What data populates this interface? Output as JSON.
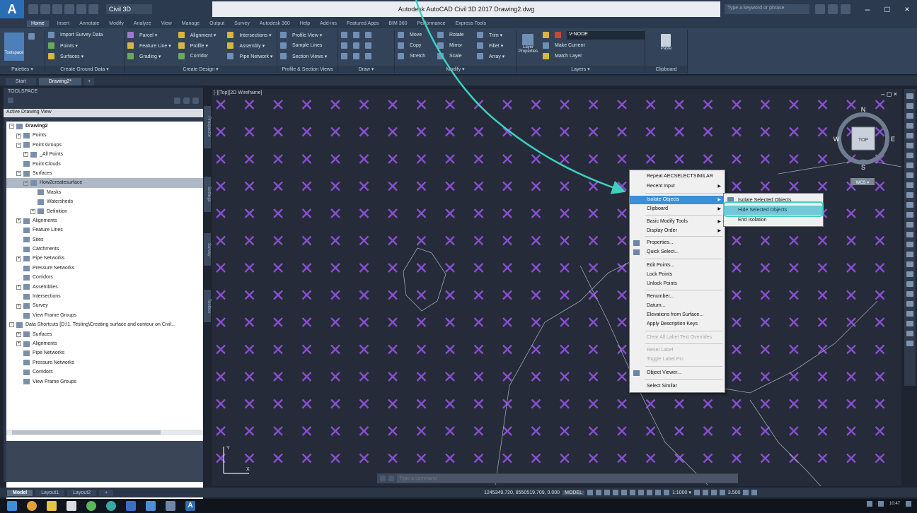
{
  "window": {
    "title": "Autodesk AutoCAD Civil 3D 2017  Drawing2.dwg",
    "workspace": "Civil 3D",
    "search_placeholder": "Type a keyword or phrase",
    "minimize": "–",
    "maximize": "□",
    "close": "×"
  },
  "ribbon_tabs": [
    "Home",
    "Insert",
    "Annotate",
    "Modify",
    "Analyze",
    "View",
    "Manage",
    "Output",
    "Survey",
    "Autodesk 360",
    "Help",
    "Add-ins",
    "Featured Apps",
    "BIM 360",
    "Performance",
    "Express Tools"
  ],
  "ribbon": {
    "toolspace": "Toolspace",
    "palettes": "Palettes ▾",
    "create_ground_data": {
      "title": "Create Ground Data ▾",
      "items": [
        "Import Survey Data",
        "Points ▾",
        "Surfaces ▾"
      ]
    },
    "create_design": {
      "title": "Create Design ▾",
      "items": [
        "Parcel ▾",
        "Feature Line ▾",
        "Grading ▾",
        "Alignment ▾",
        "Profile ▾",
        "Corridor",
        "Intersections ▾",
        "Assembly ▾",
        "Pipe Network ▾"
      ]
    },
    "profile_section": {
      "title": "Profile & Section Views",
      "items": [
        "Profile View ▾",
        "Sample Lines",
        "Section Views ▾"
      ]
    },
    "draw": {
      "title": "Draw ▾"
    },
    "modify": {
      "title": "Modify ▾",
      "items": [
        "Move",
        "Rotate",
        "Trim ▾",
        "Copy",
        "Mirror",
        "Fillet ▾",
        "Stretch",
        "Scale",
        "Array ▾"
      ]
    },
    "layers": {
      "title": "Layers ▾",
      "combo": "V-NODE",
      "items": [
        "Layer Properties",
        "Make Current",
        "Match Layer"
      ]
    },
    "clipboard": {
      "title": "Clipboard",
      "paste": "Paste"
    }
  },
  "file_tabs": [
    "Start",
    "Drawing2*"
  ],
  "toolspace": {
    "title": "TOOLSPACE",
    "view": "Active Drawing View",
    "tree": [
      {
        "label": "Drawing2",
        "level": 0,
        "expand": "−",
        "bold": true
      },
      {
        "label": "Points",
        "level": 1,
        "expand": "+"
      },
      {
        "label": "Point Groups",
        "level": 1,
        "expand": "−"
      },
      {
        "label": "_All Points",
        "level": 2,
        "expand": "+"
      },
      {
        "label": "Point Clouds",
        "level": 1,
        "expand": ""
      },
      {
        "label": "Surfaces",
        "level": 1,
        "expand": "−"
      },
      {
        "label": "How2createsurface",
        "level": 2,
        "expand": "−",
        "selected": true
      },
      {
        "label": "Masks",
        "level": 3,
        "expand": ""
      },
      {
        "label": "Watersheds",
        "level": 3,
        "expand": ""
      },
      {
        "label": "Definition",
        "level": 3,
        "expand": "+"
      },
      {
        "label": "Alignments",
        "level": 1,
        "expand": "+"
      },
      {
        "label": "Feature Lines",
        "level": 1,
        "expand": ""
      },
      {
        "label": "Sites",
        "level": 1,
        "expand": ""
      },
      {
        "label": "Catchments",
        "level": 1,
        "expand": ""
      },
      {
        "label": "Pipe Networks",
        "level": 1,
        "expand": "+"
      },
      {
        "label": "Pressure Networks",
        "level": 1,
        "expand": ""
      },
      {
        "label": "Corridors",
        "level": 1,
        "expand": ""
      },
      {
        "label": "Assemblies",
        "level": 1,
        "expand": "+"
      },
      {
        "label": "Intersections",
        "level": 1,
        "expand": ""
      },
      {
        "label": "Survey",
        "level": 1,
        "expand": "+"
      },
      {
        "label": "View Frame Groups",
        "level": 1,
        "expand": ""
      },
      {
        "label": "Data Shortcuts [D:\\1. Testing\\Creating surface and contour on Civil...",
        "level": 0,
        "expand": "−"
      },
      {
        "label": "Surfaces",
        "level": 1,
        "expand": "+"
      },
      {
        "label": "Alignments",
        "level": 1,
        "expand": "+"
      },
      {
        "label": "Pipe Networks",
        "level": 1,
        "expand": ""
      },
      {
        "label": "Pressure Networks",
        "level": 1,
        "expand": ""
      },
      {
        "label": "Corridors",
        "level": 1,
        "expand": ""
      },
      {
        "label": "View Frame Groups",
        "level": 1,
        "expand": ""
      }
    ],
    "side_tabs": [
      "Prospector",
      "Settings",
      "Survey",
      "Toolbox"
    ]
  },
  "viewport": {
    "label": "[-][Top][2D Wireframe]",
    "controls": "– ◻ ×",
    "viewcube": {
      "n": "N",
      "s": "S",
      "e": "E",
      "w": "W",
      "face": "TOP",
      "wcs": "WCS ▾"
    },
    "ucs_y": "Y",
    "ucs_x": "X",
    "marker_color": "#8a4fd1",
    "background": "#252b38"
  },
  "context_menu": {
    "items": [
      {
        "label": "Repeat AECSELECTSIMILAR",
        "top": 0
      },
      {
        "label": "Recent Input",
        "arrow": true
      },
      {
        "label": "Isolate Objects",
        "arrow": true,
        "highlight": true
      },
      {
        "label": "Clipboard",
        "arrow": true
      },
      {
        "label": "Basic Modify Tools",
        "arrow": true
      },
      {
        "label": "Display Order",
        "arrow": true
      },
      {
        "label": "Properties..."
      },
      {
        "label": "Quick Select..."
      },
      {
        "label": "Edit Points..."
      },
      {
        "label": "Lock Points"
      },
      {
        "label": "Unlock Points"
      },
      {
        "label": "Renumber..."
      },
      {
        "label": "Datum..."
      },
      {
        "label": "Elevations from Surface..."
      },
      {
        "label": "Apply Description Keys"
      },
      {
        "label": "Clear All Label Text Overrides",
        "disabled": true
      },
      {
        "label": "Reset Label",
        "disabled": true
      },
      {
        "label": "Toggle Label Pin",
        "disabled": true
      },
      {
        "label": "Object Viewer..."
      },
      {
        "label": "Select Similar"
      }
    ]
  },
  "submenu": {
    "items": [
      "Isolate Selected Objects",
      "Hide Selected Objects",
      "End Isolation"
    ]
  },
  "command_line": {
    "placeholder": "Type a command"
  },
  "layout_tabs": [
    "Model",
    "Layout1",
    "Layout2",
    "+"
  ],
  "status": {
    "coords": "1245349.720, 8550519.709, 0.000",
    "model": "MODEL",
    "scale": "1:1000 ▾",
    "scale2": "3.500",
    "time": "10:47"
  },
  "colors": {
    "hint": "#3fd0c0",
    "menu_highlight": "#3a8fd6"
  }
}
